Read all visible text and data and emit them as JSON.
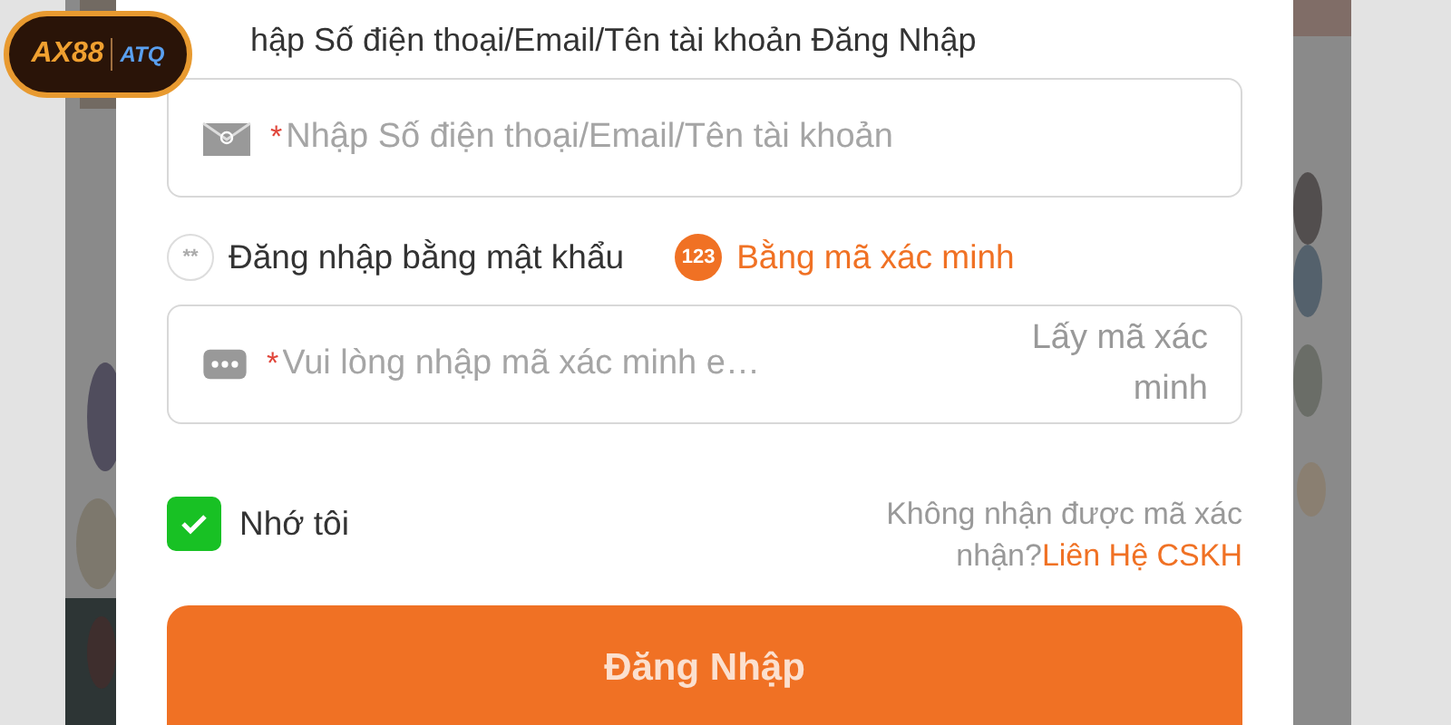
{
  "logo": {
    "brand": "AX88",
    "partner": "ATQ"
  },
  "account_field": {
    "label": "hập Số điện thoại/Email/Tên tài khoản Đăng Nhập",
    "required_mark": "*",
    "placeholder": "Nhập Số điện thoại/Email/Tên tài khoản"
  },
  "login_modes": [
    {
      "icon": "**",
      "label": "Đăng nhập bằng mật khẩu",
      "selected": false
    },
    {
      "icon": "123",
      "label": "Bằng mã xác minh",
      "selected": true
    }
  ],
  "code_field": {
    "required_mark": "*",
    "placeholder": "Vui lòng nhập mã xác minh e…",
    "action": "Lấy mã xác minh"
  },
  "remember": {
    "label": "Nhớ tôi",
    "checked": true
  },
  "help": {
    "text": "Không nhận được mã xác nhận?",
    "link": "Liên Hệ CSKH"
  },
  "submit": "Đăng Nhập"
}
